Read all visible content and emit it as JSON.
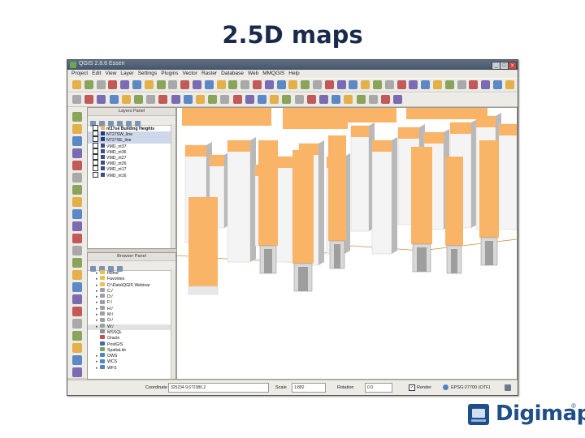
{
  "slide": {
    "title": "2.5D maps"
  },
  "window": {
    "title": "QGIS 2.8.6 Essen",
    "controls": [
      "_",
      "□",
      "x"
    ],
    "menus": [
      "Project",
      "Edit",
      "View",
      "Layer",
      "Settings",
      "Plugins",
      "Vector",
      "Raster",
      "Database",
      "Web",
      "MMQGIS",
      "Help"
    ]
  },
  "layers_panel": {
    "title": "Layers Panel",
    "layers": [
      {
        "name": "nt17se Building Heights",
        "color": "#f7b060",
        "bold": true,
        "selected": false
      },
      {
        "name": "NT27SW_line",
        "color": "#2a3a7a",
        "bold": false,
        "selected": true
      },
      {
        "name": "NT27SE_line",
        "color": "#2a3a7a",
        "bold": false,
        "selected": true
      },
      {
        "name": "VMD_nt37",
        "color": "#3a4c8a",
        "bold": false,
        "selected": false
      },
      {
        "name": "VMD_nt36",
        "color": "#3a4c8a",
        "bold": false,
        "selected": false
      },
      {
        "name": "VMD_nt27",
        "color": "#3a4c8a",
        "bold": false,
        "selected": false
      },
      {
        "name": "VMD_nt26",
        "color": "#3a4c8a",
        "bold": false,
        "selected": false
      },
      {
        "name": "VMD_nt17",
        "color": "#3a4c8a",
        "bold": false,
        "selected": false
      },
      {
        "name": "VMD_nt16",
        "color": "#3a4c8a",
        "bold": false,
        "selected": false
      }
    ]
  },
  "browser_panel": {
    "title": "Browser Panel",
    "items": [
      {
        "name": "Home",
        "icon": "folder-icon",
        "color": "#e8c150",
        "expandable": true,
        "selected": false
      },
      {
        "name": "Favorites",
        "icon": "star-folder-icon",
        "color": "#e8c150",
        "expandable": true,
        "selected": false
      },
      {
        "name": "D:\\Data\\QGIS Webinar",
        "icon": "folder-icon",
        "color": "#e8c150",
        "expandable": true,
        "selected": false
      },
      {
        "name": "C:/",
        "icon": "drive-icon",
        "color": "#9aa0a6",
        "expandable": true,
        "selected": false
      },
      {
        "name": "D:/",
        "icon": "drive-icon",
        "color": "#9aa0a6",
        "expandable": true,
        "selected": false
      },
      {
        "name": "F:/",
        "icon": "drive-icon",
        "color": "#9aa0a6",
        "expandable": true,
        "selected": false
      },
      {
        "name": "H:/",
        "icon": "drive-icon",
        "color": "#9aa0a6",
        "expandable": true,
        "selected": false
      },
      {
        "name": "M:/",
        "icon": "drive-icon",
        "color": "#9aa0a6",
        "expandable": true,
        "selected": false
      },
      {
        "name": "O:/",
        "icon": "drive-icon",
        "color": "#9aa0a6",
        "expandable": true,
        "selected": false
      },
      {
        "name": "W:/",
        "icon": "drive-icon",
        "color": "#9aa0a6",
        "expandable": true,
        "selected": true
      },
      {
        "name": "MSSQL",
        "icon": "mssql-icon",
        "color": "#8a8f99",
        "expandable": false,
        "selected": false
      },
      {
        "name": "Oracle",
        "icon": "oracle-icon",
        "color": "#c0504d",
        "expandable": false,
        "selected": false
      },
      {
        "name": "PostGIS",
        "icon": "postgis-icon",
        "color": "#3b6ea8",
        "expandable": false,
        "selected": false
      },
      {
        "name": "SpatiaLite",
        "icon": "spatialite-icon",
        "color": "#7aa35a",
        "expandable": false,
        "selected": false
      },
      {
        "name": "OWS",
        "icon": "globe-icon",
        "color": "#4d84c4",
        "expandable": true,
        "selected": false
      },
      {
        "name": "WCS",
        "icon": "globe-icon",
        "color": "#4d84c4",
        "expandable": true,
        "selected": false
      },
      {
        "name": "WFS",
        "icon": "globe-icon",
        "color": "#4d84c4",
        "expandable": true,
        "selected": false
      }
    ]
  },
  "statusbar": {
    "coordinate_label": "Coordinate",
    "coordinate_value": "325234.9,672380.2",
    "scale_label": "Scale",
    "scale_value": "1:882",
    "rotation_label": "Rotation",
    "rotation_value": "0.0",
    "render_label": "Render",
    "render_checked": true,
    "crs_label": "EPSG:27700 (OTF)"
  },
  "map": {
    "roof_color": "#f9b468",
    "wall_color": "#f4f4f4",
    "shade_color": "#b9b9b9",
    "line_color": "#d88a3a"
  },
  "logo": {
    "text": "Digimap",
    "mark": "®"
  }
}
